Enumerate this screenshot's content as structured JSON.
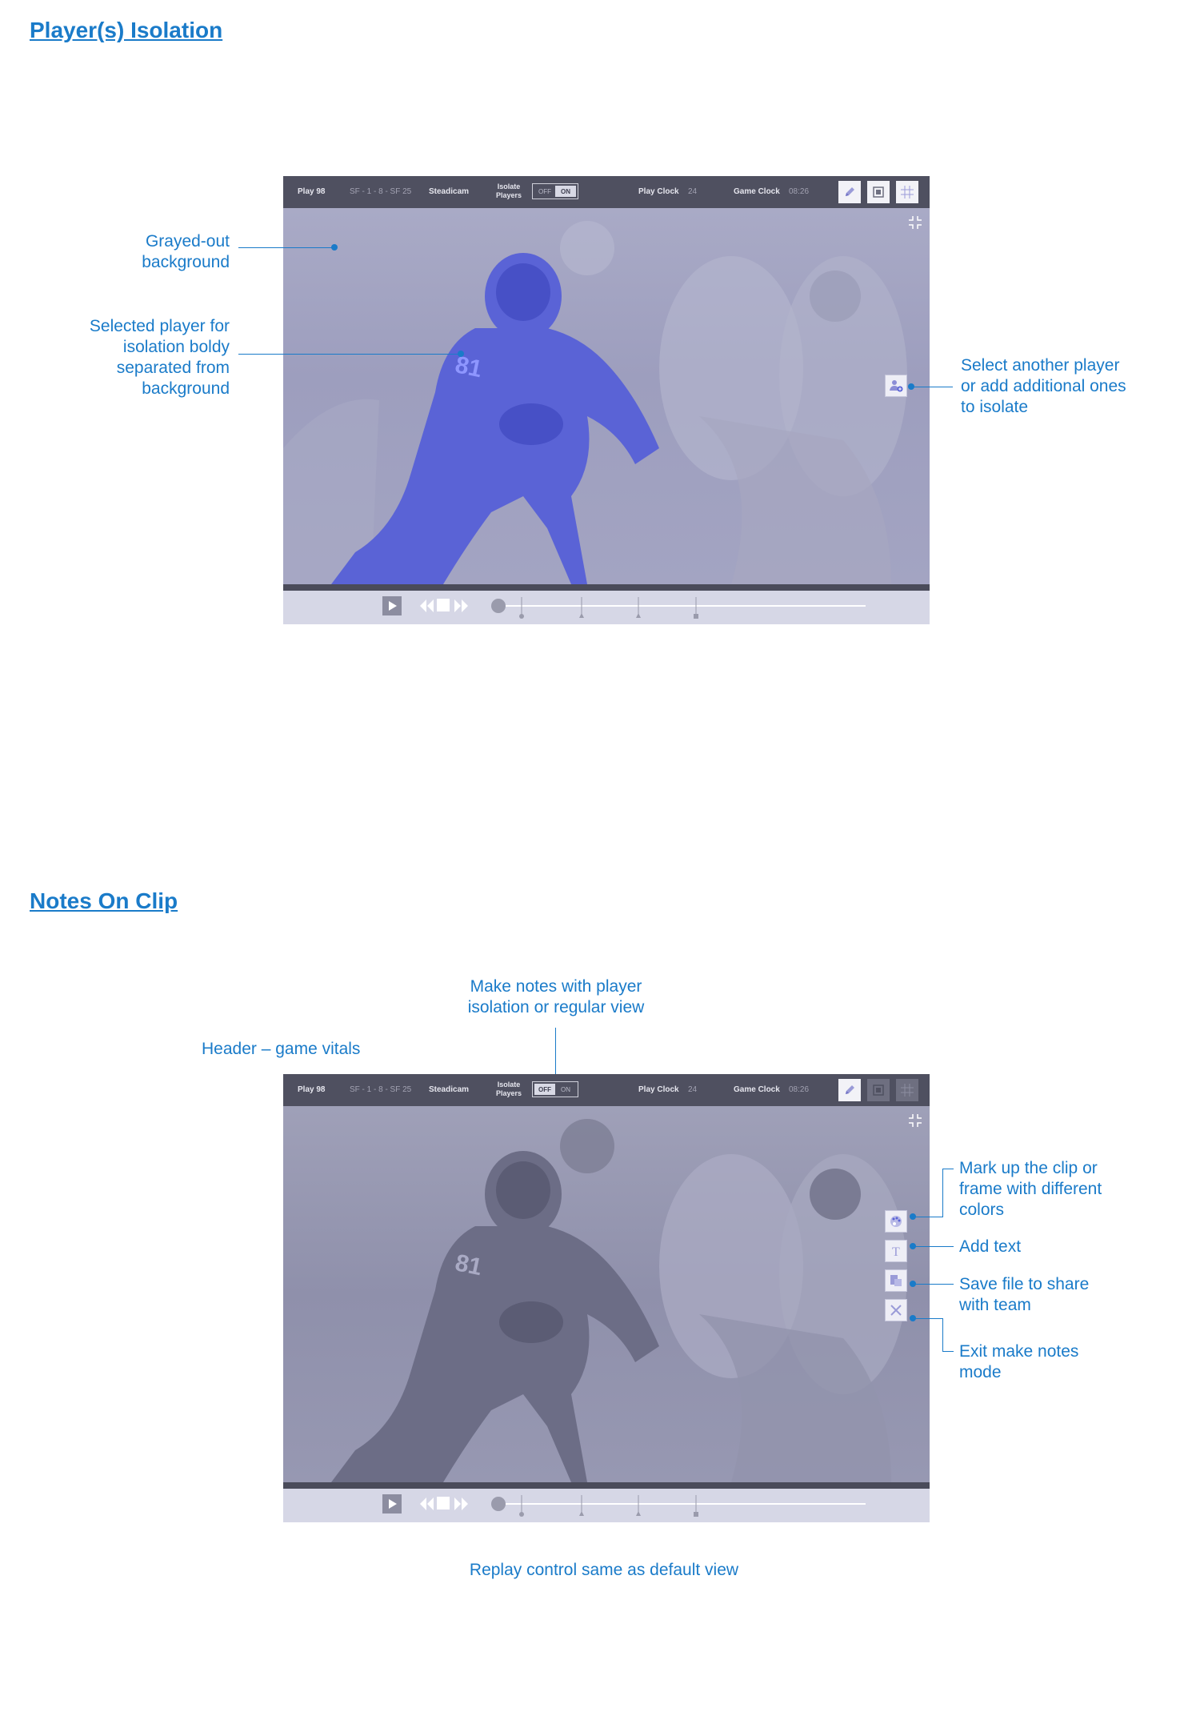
{
  "sections": {
    "isolation_title": "Player(s) Isolation",
    "notes_title": "Notes On Clip"
  },
  "player": {
    "play_label": "Play 98",
    "score": "SF - 1 - 8 - SF 25",
    "camera": "Steadicam",
    "isolate_label": "Isolate\nPlayers",
    "toggle_off": "OFF",
    "toggle_on": "ON",
    "play_clock_label": "Play Clock",
    "play_clock_value": "24",
    "game_clock_label": "Game Clock",
    "game_clock_value": "08:26"
  },
  "isolation_annotations": {
    "grayed_out": "Grayed-out\nbackground",
    "selected_player": "Selected player for\nisolation boldy\nseparated from\nbackground",
    "select_another": "Select another player\nor add additional ones\nto isolate"
  },
  "notes_annotations": {
    "make_notes": "Make notes with player\nisolation or regular view",
    "header": "Header – game vitals",
    "mark_up": "Mark up the clip or\nframe with different\ncolors",
    "add_text": "Add text",
    "save_file": "Save file to share\nwith team",
    "exit_notes": "Exit make notes\nmode",
    "replay_control": "Replay control same as default view"
  },
  "icons": {
    "pencil": "pencil-icon",
    "frame": "frame-icon",
    "grid": "grid-icon",
    "collapse": "collapse-icon",
    "add_player": "add-player-icon",
    "palette": "palette-icon",
    "text": "text-icon",
    "save": "save-icon",
    "close": "close-icon",
    "play": "play-icon",
    "rewind": "rewind-icon",
    "stop": "stop-icon",
    "forward": "forward-icon"
  },
  "colors": {
    "accent": "#1a7bc9",
    "header_bar": "#4f5060",
    "isolated_player": "#5a63d6",
    "controls_bg": "#d6d7e6"
  }
}
